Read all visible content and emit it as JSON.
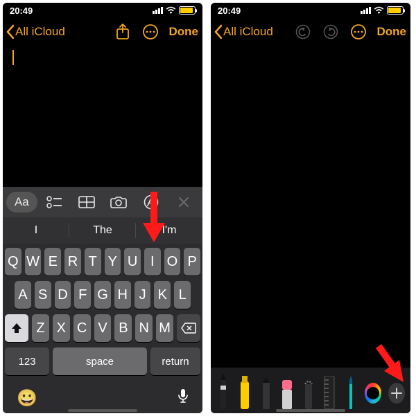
{
  "status": {
    "time": "20:49",
    "battery_pct": 84
  },
  "nav": {
    "back_label": "All iCloud",
    "done_label": "Done"
  },
  "toolbar": {
    "aa": "Aa"
  },
  "suggestions": [
    "I",
    "The",
    "I'm"
  ],
  "keyboard": {
    "row1": [
      "Q",
      "W",
      "E",
      "R",
      "T",
      "Y",
      "U",
      "I",
      "O",
      "P"
    ],
    "row2": [
      "A",
      "S",
      "D",
      "F",
      "G",
      "H",
      "J",
      "K",
      "L"
    ],
    "row3": [
      "Z",
      "X",
      "C",
      "V",
      "B",
      "N",
      "M"
    ],
    "num": "123",
    "space": "space",
    "return": "return"
  },
  "colors": {
    "accent": "#f5a623"
  }
}
